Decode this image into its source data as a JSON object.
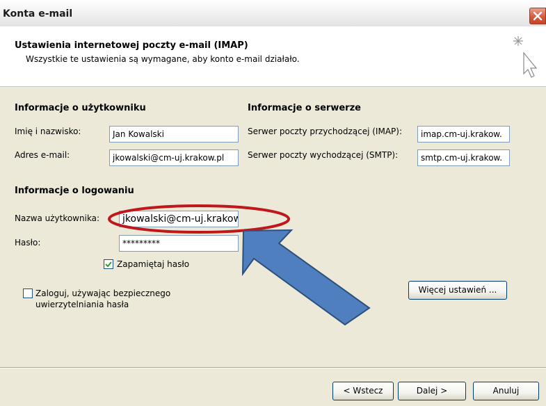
{
  "window": {
    "title": "Konta e-mail",
    "close_icon": "close-icon"
  },
  "header": {
    "title": "Ustawienia internetowej poczty e-mail (IMAP)",
    "subtitle": "Wszystkie te ustawienia są wymagane, aby konto e-mail działało.",
    "icon": "wizard-sparkle-cursor-icon"
  },
  "user_info": {
    "heading": "Informacje o użytkowniku",
    "name_label": "Imię i nazwisko:",
    "name_value": "Jan Kowalski",
    "email_label": "Adres e-mail:",
    "email_value": "jkowalski@cm-uj.krakow.pl"
  },
  "server_info": {
    "heading": "Informacje o serwerze",
    "incoming_label": "Serwer poczty przychodzącej (IMAP):",
    "incoming_value": "imap.cm-uj.krakow.",
    "outgoing_label": "Serwer poczty wychodzącej (SMTP):",
    "outgoing_value": "smtp.cm-uj.krakow."
  },
  "login_info": {
    "heading": "Informacje o logowaniu",
    "username_label": "Nazwa użytkownika:",
    "username_value": "jkowalski@cm-uj.krakow.pl",
    "password_label": "Hasło:",
    "password_value": "*********",
    "remember_label": "Zapamiętaj hasło",
    "remember_checked": true,
    "spa_label_line1": "Zaloguj, używając bezpiecznego",
    "spa_label_line2": "uwierzytelniania hasła",
    "spa_checked": false
  },
  "buttons": {
    "more_settings": "Więcej ustawień ...",
    "back": "< Wstecz",
    "next": "Dalej >",
    "cancel": "Anuluj"
  },
  "annotations": {
    "highlight_color": "#c0171c",
    "arrow_color": "#4f7fbf",
    "arrow_outline_color": "#2d4f7c"
  }
}
